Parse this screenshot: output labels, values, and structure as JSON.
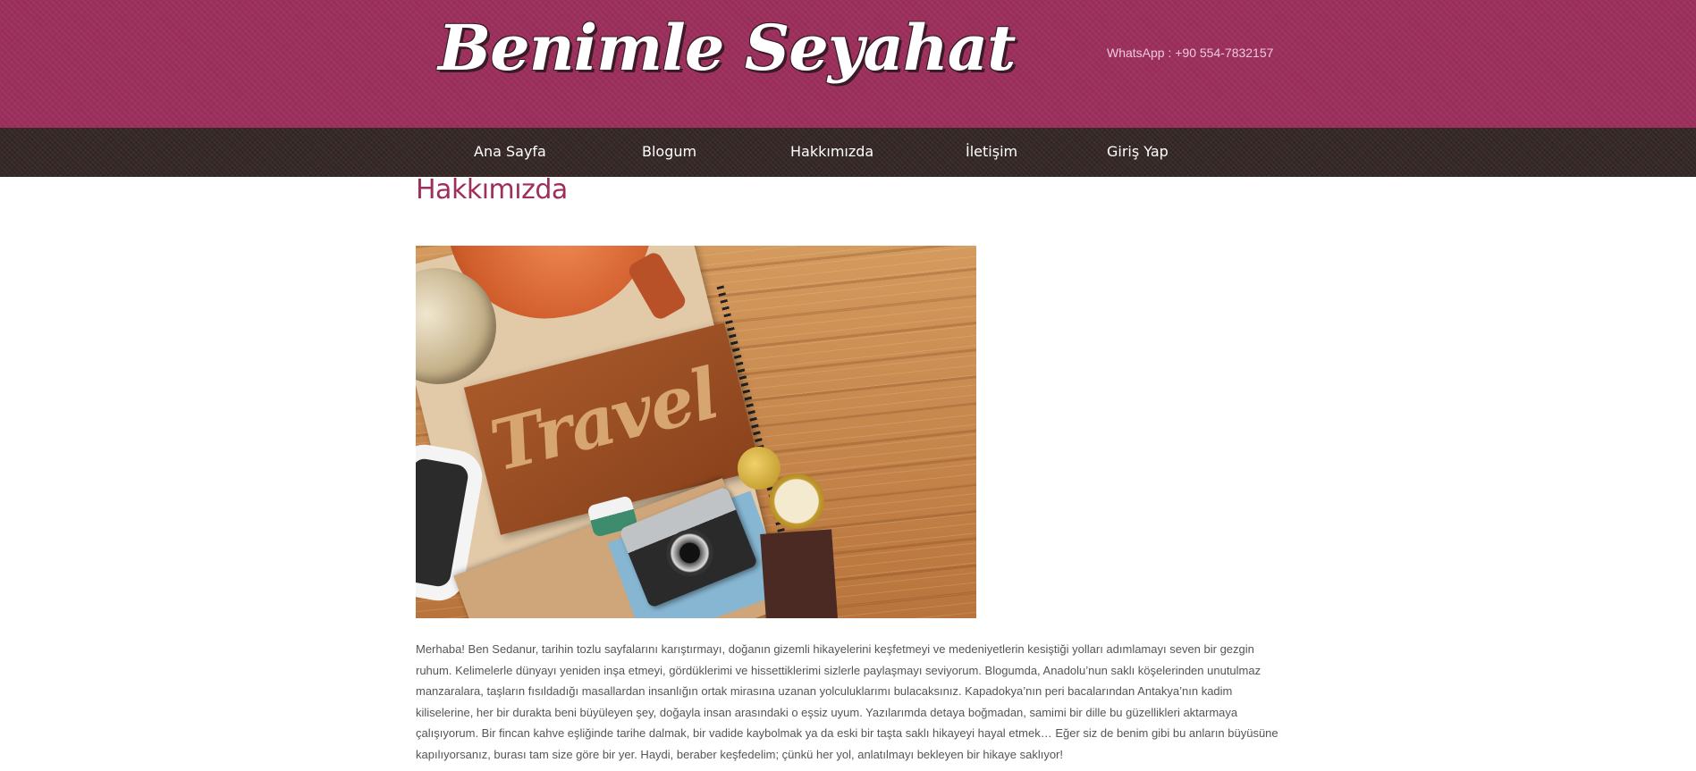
{
  "header": {
    "logo_text": "Benimle Seyahat",
    "contact": "WhatsApp : +90 554-7832157"
  },
  "nav": {
    "items": [
      {
        "label": "Ana Sayfa"
      },
      {
        "label": "Blogum"
      },
      {
        "label": "Hakkımızda"
      },
      {
        "label": "İletişim"
      },
      {
        "label": "Giriş Yap"
      }
    ]
  },
  "main": {
    "title": "Hakkımızda",
    "image": {
      "word": "Travel"
    },
    "paragraph": "Merhaba! Ben Sedanur, tarihin tozlu sayfalarını karıştırmayı, doğanın gizemli hikayelerini keşfetmeyi ve medeniyetlerin kesiştiği yolları adımlamayı seven bir gezgin ruhum. Kelimelerle dünyayı yeniden inşa etmeyi, gördüklerimi ve hissettiklerimi sizlerle paylaşmayı seviyorum. Blogumda, Anadolu’nun saklı köşelerinden unutulmaz manzaralara, taşların fısıldadığı masallardan insanlığın ortak mirasına uzanan yolculuklarımı bulacaksınız. Kapadokya’nın peri bacalarından Antakya’nın kadim kiliselerine, her bir durakta beni büyüleyen şey, doğayla insan arasındaki o eşsiz uyum. Yazılarımda detaya boğmadan, samimi bir dille bu güzellikleri aktarmaya çalışıyorum. Bir fincan kahve eşliğinde tarihe dalmak, bir vadide kaybolmak ya da eski bir taşta saklı hikayeyi hayal etmek… Eğer siz de benim gibi bu anların büyüsüne kapılıyorsanız, burası tam size göre bir yer. Haydi, beraber keşfedelim; çünkü her yol, anlatılmayı bekleyen bir hikaye saklıyor!"
  },
  "colors": {
    "header_bg": "#9c2f5c",
    "nav_bg": "#352826",
    "title": "#9c2f5c",
    "body_text": "#555555"
  }
}
